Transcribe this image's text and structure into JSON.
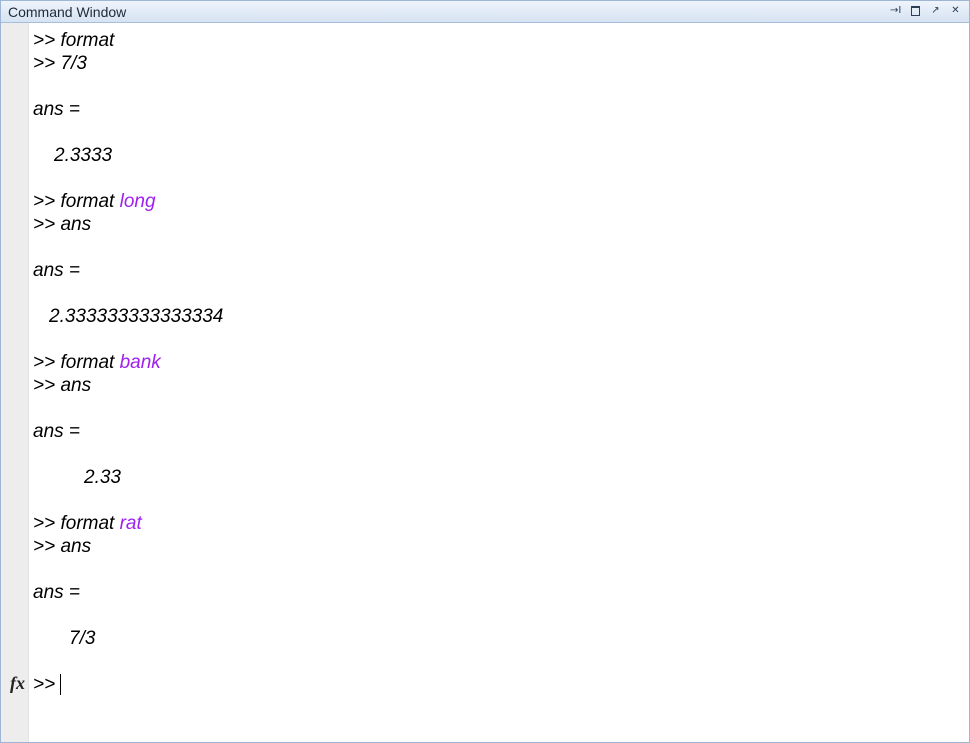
{
  "window": {
    "title": "Command Window",
    "controls": {
      "undock_icon": "→I",
      "maximize_icon": "maximize",
      "popout_icon": "↗",
      "close_icon": "✕"
    }
  },
  "colors": {
    "keyword": "#a020f0",
    "text": "#000000",
    "gutter": "#ededed",
    "title_bar": "#d6e3f2"
  },
  "session": [
    {
      "prompt": ">> ",
      "command": "format",
      "arg": ""
    },
    {
      "prompt": ">> ",
      "command": "7/3",
      "arg": ""
    },
    {
      "output": "ans ="
    },
    {
      "output": "2.3333"
    },
    {
      "prompt": ">> ",
      "command": "format ",
      "arg": "long"
    },
    {
      "prompt": ">> ",
      "command": "ans",
      "arg": ""
    },
    {
      "output": "ans ="
    },
    {
      "output": "2.333333333333334"
    },
    {
      "prompt": ">> ",
      "command": "format ",
      "arg": "bank"
    },
    {
      "prompt": ">> ",
      "command": "ans",
      "arg": ""
    },
    {
      "output": "ans ="
    },
    {
      "output": "2.33"
    },
    {
      "prompt": ">> ",
      "command": "format ",
      "arg": "rat"
    },
    {
      "prompt": ">> ",
      "command": "ans",
      "arg": ""
    },
    {
      "output": "ans ="
    },
    {
      "output": "7/3"
    }
  ],
  "input": {
    "fx_label": "fx",
    "prompt": ">> ",
    "value": ""
  }
}
